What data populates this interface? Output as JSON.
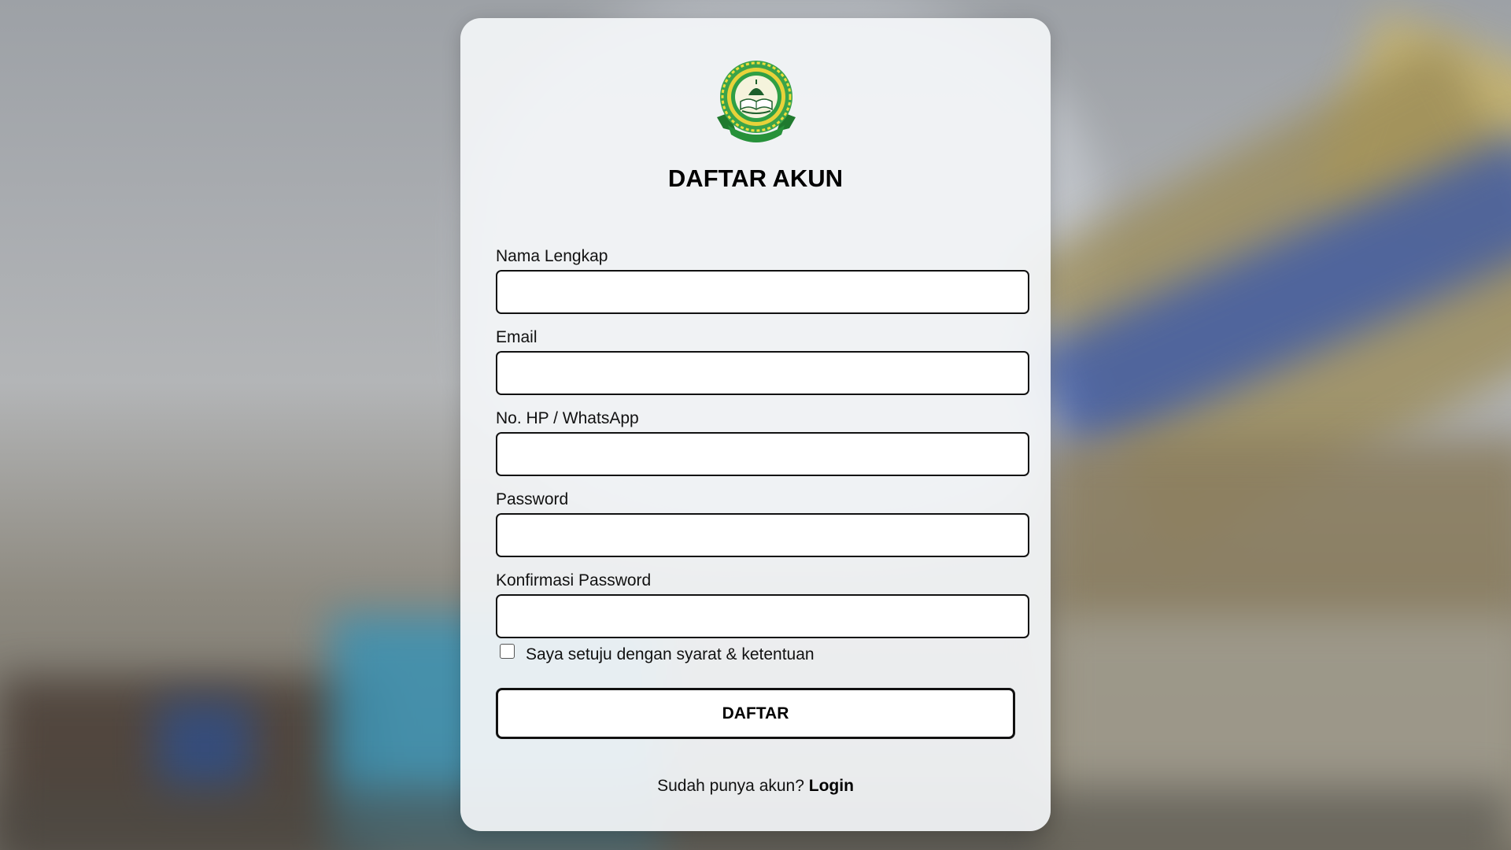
{
  "page": {
    "title": "DAFTAR AKUN"
  },
  "logo": {
    "icon": "school-emblem-icon",
    "colors": {
      "green": "#2e9e3a",
      "yellow": "#e8d23a",
      "dark_green": "#1f6f2a"
    }
  },
  "form": {
    "fields": [
      {
        "label": "Nama Lengkap",
        "value": "",
        "placeholder": "",
        "type": "text"
      },
      {
        "label": "Email",
        "value": "",
        "placeholder": "",
        "type": "email"
      },
      {
        "label": "No. HP / WhatsApp",
        "value": "",
        "placeholder": "",
        "type": "tel"
      },
      {
        "label": "Password",
        "value": "",
        "placeholder": "",
        "type": "password"
      },
      {
        "label": "Konfirmasi Password",
        "value": "",
        "placeholder": "",
        "type": "password"
      }
    ],
    "agree_label": "Saya setuju dengan syarat & ketentuan",
    "agree_checked": false,
    "submit_label": "DAFTAR"
  },
  "footer": {
    "prompt": "Sudah punya akun?",
    "login_link": "Login"
  }
}
